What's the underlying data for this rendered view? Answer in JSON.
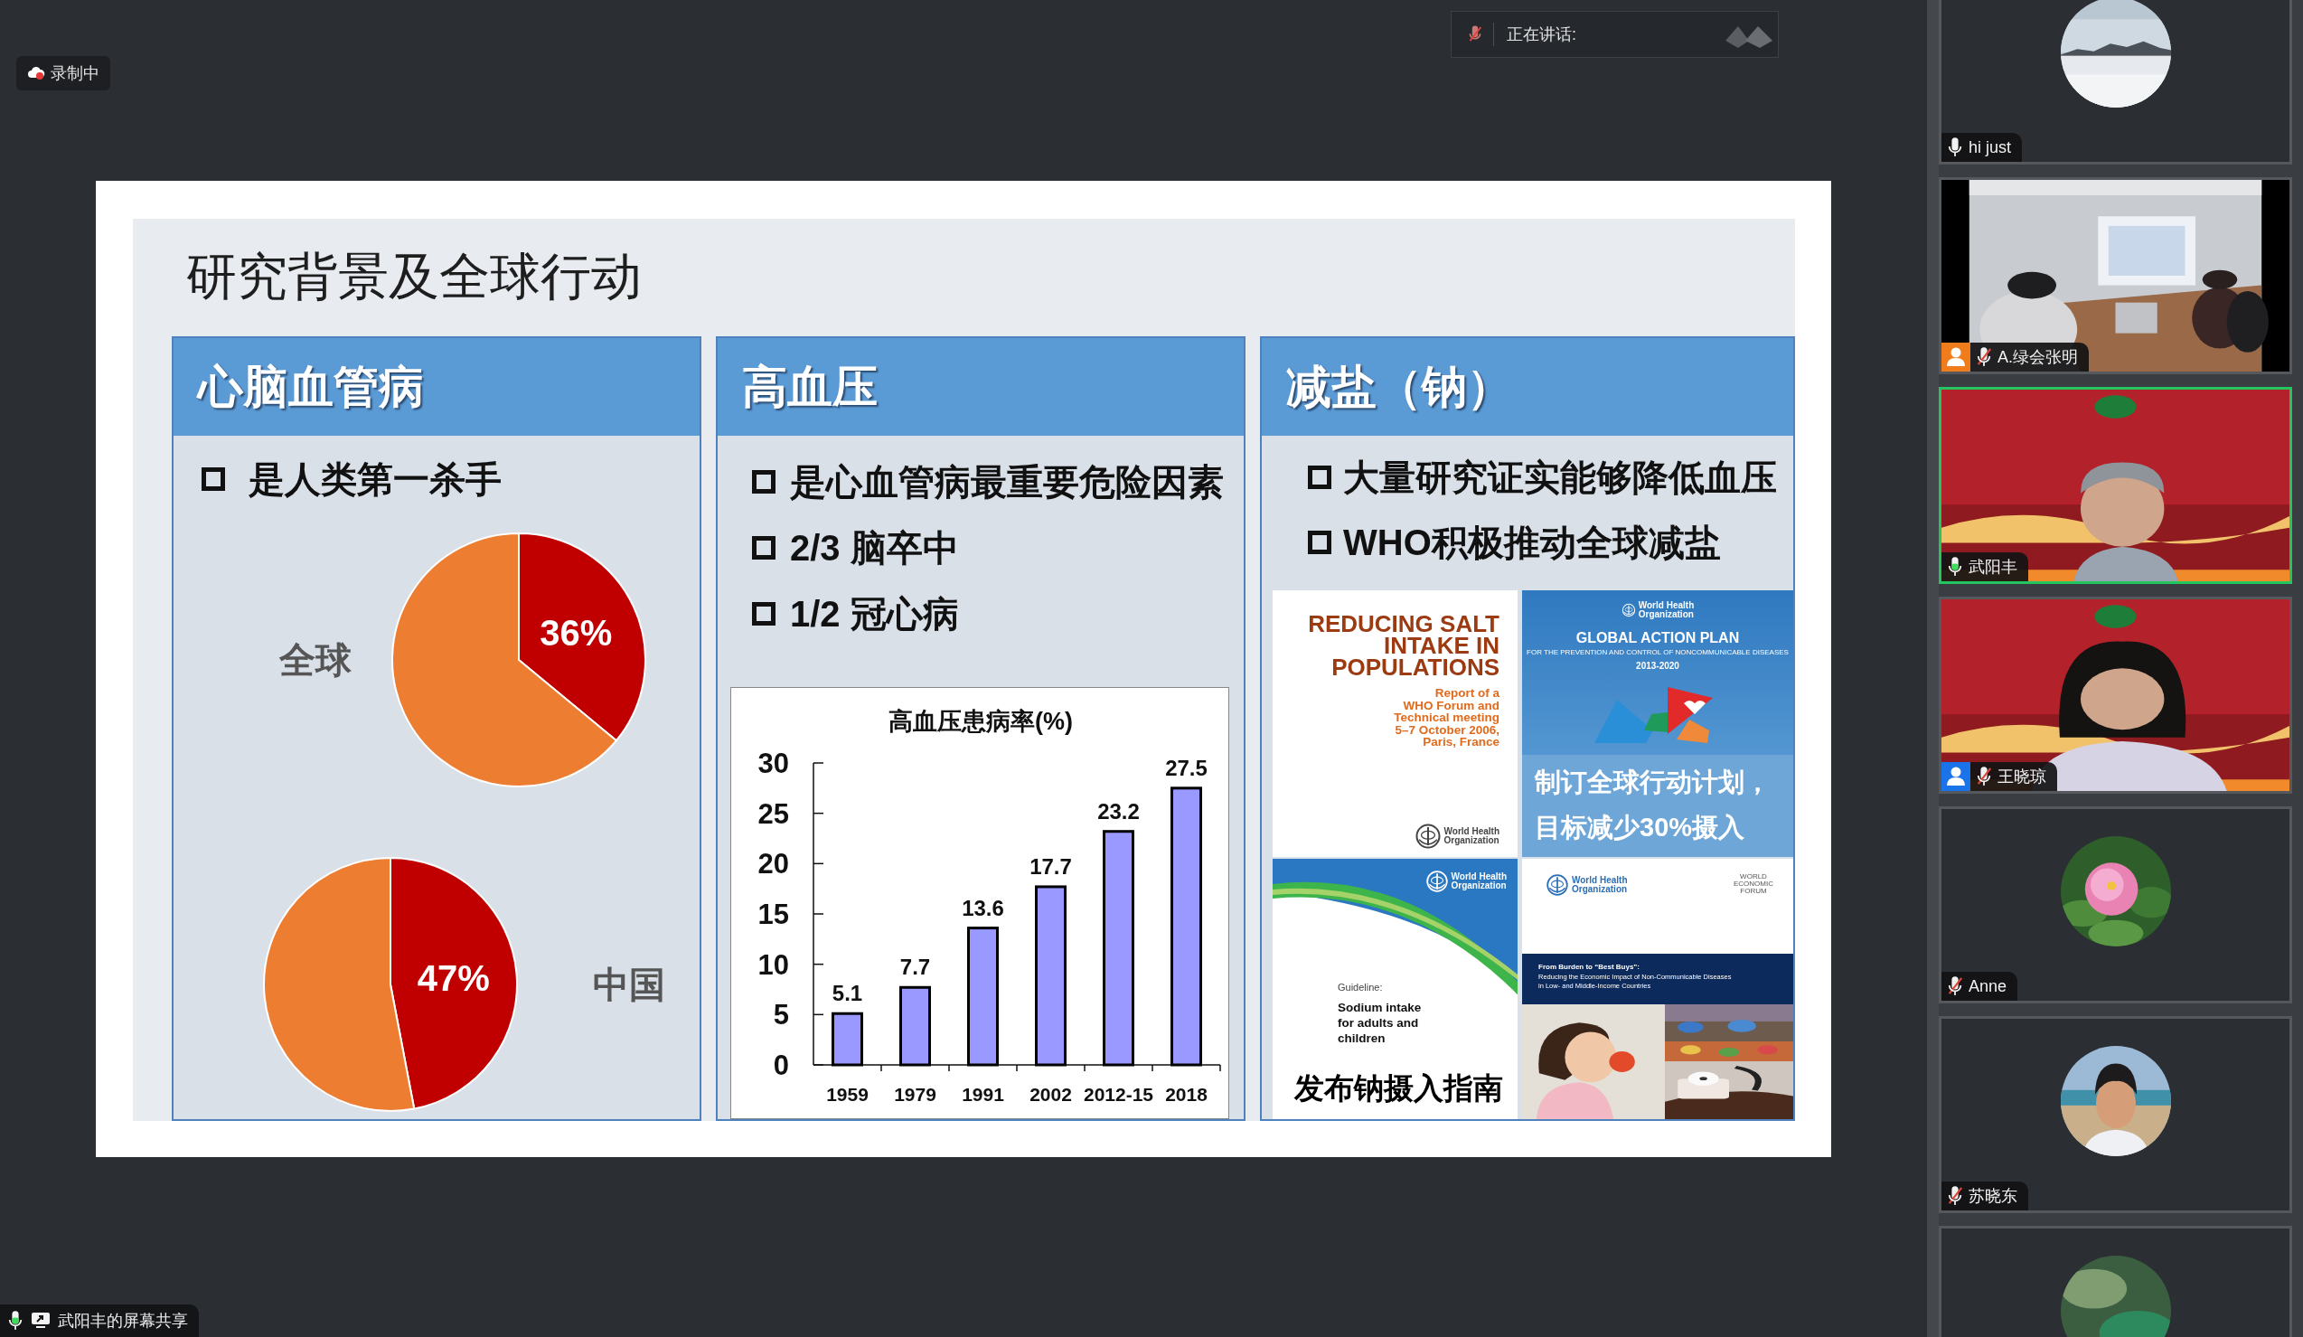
{
  "recording": {
    "label": "录制中"
  },
  "speaking": {
    "label": "正在讲话:"
  },
  "slide": {
    "title": "研究背景及全球行动",
    "columns": [
      {
        "kind": "pies",
        "heading": "心脑血管病",
        "bullets": [
          "是人类第一杀手"
        ],
        "pies": [
          {
            "label": "全球",
            "chart_data": {
              "type": "pie",
              "values": [
                36,
                64
              ],
              "value_labels": [
                "36%",
                null
              ]
            }
          },
          {
            "label": "中国",
            "chart_data": {
              "type": "pie",
              "values": [
                47,
                53
              ],
              "value_labels": [
                "47%",
                null
              ]
            }
          }
        ]
      },
      {
        "kind": "bars",
        "heading": "高血压",
        "bullets": [
          "是心血管病最重要危险因素",
          "2/3 脑卒中",
          "1/2 冠心病"
        ],
        "chart_data": {
          "type": "bar",
          "title": "高血压患病率(%)",
          "categories": [
            "1959",
            "1979",
            "1991",
            "2002",
            "2012-15",
            "2018"
          ],
          "values": [
            5.1,
            7.7,
            13.6,
            17.7,
            23.2,
            27.5
          ],
          "ylim": [
            0,
            30
          ],
          "yticks": [
            0,
            5,
            10,
            15,
            20,
            25,
            30
          ],
          "data_labels": true
        }
      },
      {
        "kind": "covers",
        "heading": "减盐（钠）",
        "bullets": [
          "大量研究证实能够降低血压",
          "WHO积极推动全球减盐"
        ],
        "covers": [
          {
            "kind": "report",
            "title_lines": [
              "REDUCING SALT",
              "INTAKE IN",
              "POPULATIONS"
            ],
            "subtitle_lines": [
              "Report of a",
              "WHO Forum and",
              "Technical meeting",
              "5–7 October 2006,",
              "Paris, France"
            ],
            "publisher": [
              "World Health",
              "Organization"
            ]
          },
          {
            "kind": "plan",
            "publisher": [
              "World Health",
              "Organization"
            ],
            "title": "GLOBAL ACTION PLAN",
            "subtitle": "FOR THE PREVENTION AND CONTROL OF NONCOMMUNICABLE DISEASES",
            "years": "2013-2020",
            "caption_lines": [
              "制订全球行动计划，",
              "目标减少30%摄入"
            ]
          },
          {
            "kind": "guideline",
            "publisher": [
              "World Health",
              "Organization"
            ],
            "label": "Guideline:",
            "title_lines": [
              "Sodium intake",
              "for adults and",
              "children"
            ],
            "caption": "发布钠摄入指南"
          },
          {
            "kind": "brief",
            "publisher": [
              "World Health",
              "Organization"
            ],
            "partner_lines": [
              "WORLD",
              "ECONOMIC",
              "FORUM"
            ],
            "title": "From Burden to “Best Buys”:",
            "subtitle_lines": [
              "Reducing the Economic Impact of Non-Communicable Diseases",
              "in Low- and Middle-Income Countries"
            ]
          }
        ]
      }
    ]
  },
  "participants": [
    {
      "kind": "avatar",
      "name": "hi just",
      "muted": false,
      "speaking": false,
      "active": false
    },
    {
      "kind": "video",
      "name": "A.绿会张明",
      "muted": true,
      "speaking": false,
      "color": "#f07c1c",
      "active": false
    },
    {
      "kind": "video",
      "name": "武阳丰",
      "muted": false,
      "speaking": true,
      "active": true
    },
    {
      "kind": "video",
      "name": "王晓琼",
      "muted": true,
      "speaking": false,
      "color": "#1a73e8",
      "active": false
    },
    {
      "kind": "avatar",
      "name": "Anne",
      "muted": true,
      "speaking": false,
      "active": false
    },
    {
      "kind": "avatar",
      "name": "苏晓东",
      "muted": true,
      "speaking": false,
      "active": false
    },
    {
      "kind": "avatar",
      "active": false
    }
  ],
  "share_bar": {
    "label": "武阳丰的屏幕共享",
    "muted": false,
    "speaking": true
  }
}
